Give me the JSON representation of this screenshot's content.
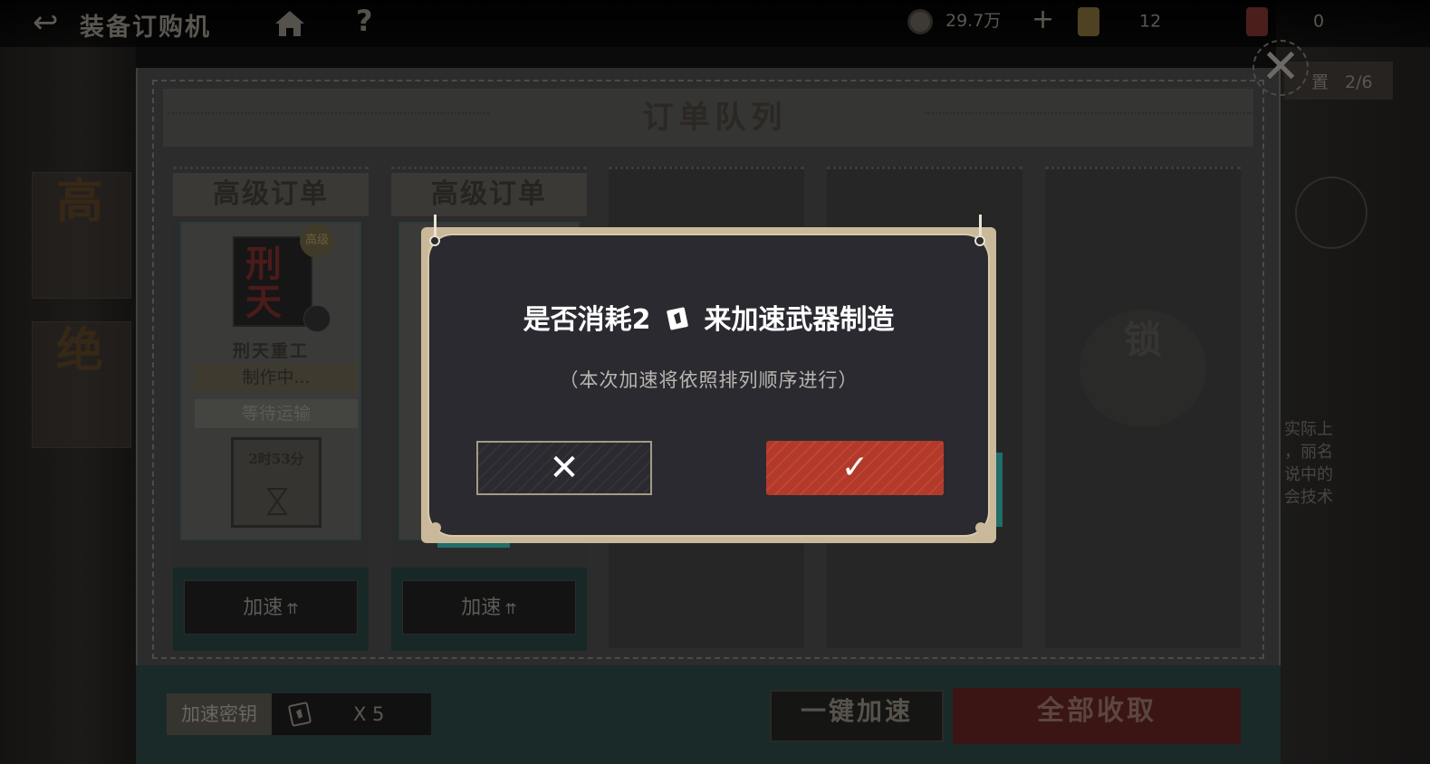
{
  "topbar": {
    "title": "装备订购机",
    "help": "?",
    "coins": "29.7万",
    "plus": "+",
    "gold_count": "12",
    "red_count": "0"
  },
  "background": {
    "side_char_1": "高",
    "side_char_2": "绝",
    "right_btn_label": "置",
    "right_btn_count": "2/6",
    "right_text": "实际上\n，丽名\n说中的\n会技术"
  },
  "panel": {
    "title": "订单队列",
    "close": "✕"
  },
  "slots": [
    {
      "label": "高级订单",
      "item_name": "刑天重工",
      "item_art_text": "刑\n天",
      "badge": "高级",
      "status_making": "制作中...",
      "status_wait": "等待运输",
      "timer": "2时53分",
      "speed_button": "加速"
    },
    {
      "label": "高级订单",
      "speed_button": "加速"
    },
    {},
    {},
    {
      "lock_text": "锁"
    }
  ],
  "bottom": {
    "key_label": "加速密钥",
    "key_count": "X 5",
    "speed_all": "一键加速",
    "collect_all": "全部收取"
  },
  "dialog": {
    "title_prefix": "是否消耗2",
    "title_suffix": "来加速武器制造",
    "subtitle": "（本次加速将依照排列顺序进行）",
    "cancel_symbol": "✕",
    "confirm_symbol": "✓"
  },
  "colors": {
    "confirm_red": "#b23a2b",
    "dialog_bg": "#2b2a31",
    "frame_tan": "#c9b99a",
    "teal": "#1f6e6a"
  }
}
